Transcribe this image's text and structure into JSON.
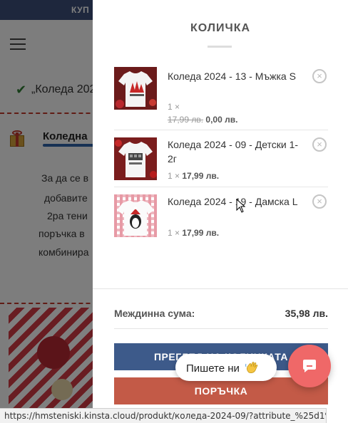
{
  "background": {
    "topbar_text": "КУП",
    "notice_text": "„Коледа 202",
    "promo_title": "Коледна",
    "promo_lines": [
      "За да се в",
      "добавите",
      "2ра тени",
      "поръчка в",
      "комбинира"
    ]
  },
  "cart": {
    "title": "КОЛИЧКА",
    "items": [
      {
        "name": "Коледа 2024 - 13 - Мъжка S",
        "qty": "1 ×",
        "old_price": "17,99 лв.",
        "price": "0,00 лв.",
        "remove": "×"
      },
      {
        "name": "Коледа 2024 - 09 - Детски 1-2г",
        "qty": "1 ×",
        "price": "17,99 лв.",
        "remove": "×"
      },
      {
        "name": "Коледа 2024 - 19 - Дамска L",
        "qty": "1 ×",
        "price": "17,99 лв.",
        "remove": "×"
      }
    ],
    "subtotal_label": "Междинна сума:",
    "subtotal_value": "35,98 лв.",
    "view_cart_label": "ПРЕГЛЕД НА КОЛИЧКАТА",
    "checkout_label": "ПОРЪЧКА"
  },
  "chat": {
    "bubble_text": "Пишете ни",
    "bubble_icon": "waving-hand-icon",
    "launcher_icon": "chat-icon",
    "accent": "#ef6868"
  },
  "status_bar": {
    "url": "https://hmsteniski.kinsta.cloud/produkt/коледа-2024-09/?attribute_%25d1%2580..."
  },
  "colors": {
    "view_cart_button": "#3d5a8a",
    "checkout_button": "#c35a47",
    "topbar": "#3d4f7a"
  }
}
